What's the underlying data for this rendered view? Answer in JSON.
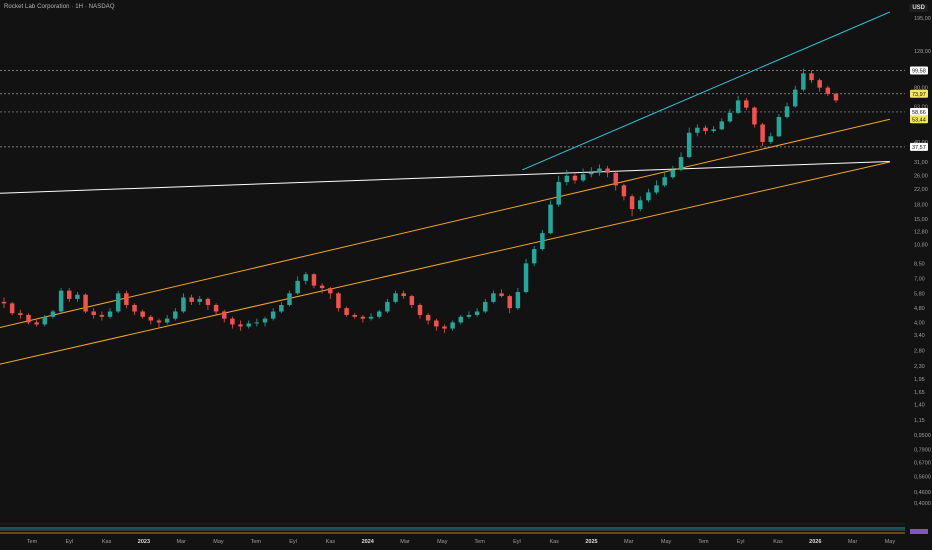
{
  "header": {
    "title": "Rocket Lab Corporation · 1H · NASDAQ",
    "currency": "USD"
  },
  "chart_data": {
    "type": "candlestick",
    "title": "Rocket Lab Corporation · 1H · NASDAQ",
    "y_scale": "log",
    "ylim": [
      0.33,
      210
    ],
    "y_ticks": [
      "195,00",
      "128,00",
      "80,00",
      "63,00",
      "40,00",
      "31,00",
      "26,00",
      "22,00",
      "18,00",
      "15,00",
      "12,80",
      "10,80",
      "8,50",
      "7,00",
      "5,80",
      "4,80",
      "4,00",
      "3,40",
      "2,80",
      "2,30",
      "1,95",
      "1,65",
      "1,40",
      "1,15",
      "0,9500",
      "0,7900",
      "0,6700",
      "0,5600",
      "0,4600",
      "0,4000"
    ],
    "x_ticks": [
      "Tem",
      "Eyl",
      "Kas",
      "2023",
      "Mar",
      "May",
      "Tem",
      "Eyl",
      "Kas",
      "2024",
      "Mar",
      "May",
      "Tem",
      "Eyl",
      "Kas",
      "2025",
      "Mar",
      "May",
      "Tem",
      "Eyl",
      "Kas",
      "2026",
      "Mar",
      "May"
    ],
    "x_ticks_bold": [
      "2023",
      "2024",
      "2025",
      "2026"
    ],
    "price_labels": [
      {
        "text": "99,58",
        "value": 99.58,
        "style": "white"
      },
      {
        "text": "73,97",
        "value": 73.97,
        "style": "yellow"
      },
      {
        "text": "58,66",
        "value": 58.66,
        "style": "white"
      },
      {
        "text": "53,44",
        "value": 53.44,
        "style": "yellow"
      },
      {
        "text": "37,57",
        "value": 37.57,
        "style": "white"
      }
    ],
    "horizontal_levels": [
      99.58,
      73.97,
      58.66,
      37.57
    ],
    "trendlines": [
      {
        "color": "#ffffff",
        "from": [
          "Tem 2022",
          20.8
        ],
        "to": [
          "May 2026",
          31.2
        ]
      },
      {
        "color": "#f5a623",
        "from": [
          "Tem 2022",
          3.75
        ],
        "to": [
          "May 2026",
          53.44
        ]
      },
      {
        "color": "#f5a623",
        "from": [
          "Tem 2022",
          2.35
        ],
        "to": [
          "May 2026",
          31.0
        ]
      },
      {
        "color": "#26c6da",
        "from": [
          "Kas 2024",
          28.0
        ],
        "to": [
          "May 2026",
          210
        ]
      }
    ],
    "candles": [
      [
        5.2,
        5.1,
        5.5,
        4.8
      ],
      [
        5.1,
        4.5,
        5.2,
        4.4
      ],
      [
        4.5,
        4.4,
        4.7,
        4.2
      ],
      [
        4.4,
        4.0,
        4.5,
        3.9
      ],
      [
        4.0,
        3.9,
        4.2,
        3.8
      ],
      [
        3.9,
        4.3,
        4.4,
        3.8
      ],
      [
        4.3,
        4.6,
        4.7,
        4.2
      ],
      [
        4.6,
        6.0,
        6.2,
        4.5
      ],
      [
        6.0,
        5.4,
        6.2,
        5.2
      ],
      [
        5.4,
        5.7,
        5.9,
        5.2
      ],
      [
        5.7,
        4.6,
        5.8,
        4.5
      ],
      [
        4.6,
        4.4,
        4.8,
        4.2
      ],
      [
        4.4,
        4.3,
        4.6,
        4.1
      ],
      [
        4.3,
        4.6,
        4.8,
        4.2
      ],
      [
        4.6,
        5.8,
        6.0,
        4.5
      ],
      [
        5.8,
        5.0,
        6.0,
        4.8
      ],
      [
        5.0,
        4.6,
        5.1,
        4.4
      ],
      [
        4.6,
        4.3,
        4.7,
        4.2
      ],
      [
        4.3,
        4.1,
        4.4,
        3.9
      ],
      [
        4.1,
        4.0,
        4.2,
        3.7
      ],
      [
        4.0,
        4.2,
        4.4,
        3.9
      ],
      [
        4.2,
        4.6,
        4.8,
        4.1
      ],
      [
        4.6,
        5.5,
        5.8,
        4.5
      ],
      [
        5.5,
        5.2,
        5.7,
        5.0
      ],
      [
        5.2,
        5.4,
        5.6,
        5.0
      ],
      [
        5.4,
        5.0,
        5.5,
        4.7
      ],
      [
        5.0,
        4.6,
        5.1,
        4.4
      ],
      [
        4.6,
        4.2,
        4.7,
        4.0
      ],
      [
        4.2,
        3.9,
        4.3,
        3.7
      ],
      [
        3.9,
        3.8,
        4.1,
        3.6
      ],
      [
        3.8,
        3.95,
        4.1,
        3.7
      ],
      [
        3.95,
        4.0,
        4.2,
        3.8
      ],
      [
        4.0,
        4.2,
        4.3,
        3.8
      ],
      [
        4.2,
        4.6,
        4.8,
        4.1
      ],
      [
        4.6,
        5.0,
        5.2,
        4.5
      ],
      [
        5.0,
        5.8,
        6.0,
        4.9
      ],
      [
        5.8,
        6.8,
        7.2,
        5.7
      ],
      [
        6.8,
        7.4,
        7.6,
        6.5
      ],
      [
        7.4,
        6.4,
        7.5,
        6.2
      ],
      [
        6.4,
        6.2,
        6.6,
        5.8
      ],
      [
        6.2,
        5.8,
        6.3,
        5.4
      ],
      [
        5.8,
        4.8,
        5.9,
        4.6
      ],
      [
        4.8,
        4.4,
        4.9,
        4.3
      ],
      [
        4.4,
        4.3,
        4.5,
        4.2
      ],
      [
        4.3,
        4.2,
        4.4,
        4.0
      ],
      [
        4.2,
        4.3,
        4.5,
        4.1
      ],
      [
        4.3,
        4.6,
        4.7,
        4.2
      ],
      [
        4.6,
        5.2,
        5.4,
        4.5
      ],
      [
        5.2,
        5.8,
        6.0,
        5.1
      ],
      [
        5.8,
        5.6,
        6.0,
        5.4
      ],
      [
        5.6,
        5.0,
        5.7,
        4.8
      ],
      [
        5.0,
        4.4,
        5.1,
        4.2
      ],
      [
        4.4,
        4.1,
        4.5,
        3.9
      ],
      [
        4.1,
        3.8,
        4.2,
        3.6
      ],
      [
        3.8,
        3.7,
        3.9,
        3.5
      ],
      [
        3.7,
        4.0,
        4.1,
        3.6
      ],
      [
        4.0,
        4.3,
        4.4,
        3.9
      ],
      [
        4.3,
        4.4,
        4.6,
        4.2
      ],
      [
        4.4,
        4.6,
        4.8,
        4.3
      ],
      [
        4.6,
        5.2,
        5.4,
        4.5
      ],
      [
        5.2,
        5.8,
        6.0,
        5.1
      ],
      [
        5.8,
        5.6,
        6.1,
        5.5
      ],
      [
        5.6,
        4.8,
        5.7,
        4.5
      ],
      [
        4.8,
        5.9,
        6.2,
        4.7
      ],
      [
        5.9,
        8.5,
        9.0,
        5.8
      ],
      [
        8.5,
        10.2,
        10.6,
        8.2
      ],
      [
        10.2,
        12.5,
        13.0,
        10.0
      ],
      [
        12.5,
        18.0,
        19.0,
        12.3
      ],
      [
        18.0,
        24.0,
        26.0,
        17.5
      ],
      [
        24.0,
        26.0,
        28.0,
        23.0
      ],
      [
        26.0,
        24.5,
        27.0,
        23.5
      ],
      [
        24.5,
        26.5,
        28.5,
        24.0
      ],
      [
        26.5,
        27.0,
        29.0,
        25.5
      ],
      [
        27.0,
        28.5,
        30.0,
        26.0
      ],
      [
        28.5,
        27.0,
        29.5,
        25.5
      ],
      [
        27.0,
        23.0,
        27.5,
        21.5
      ],
      [
        23.0,
        20.0,
        23.5,
        19.0
      ],
      [
        20.0,
        17.0,
        20.5,
        15.5
      ],
      [
        17.0,
        19.0,
        20.0,
        16.5
      ],
      [
        19.0,
        21.0,
        22.0,
        18.5
      ],
      [
        21.0,
        23.0,
        24.5,
        20.5
      ],
      [
        23.0,
        25.5,
        27.0,
        22.5
      ],
      [
        25.5,
        28.0,
        29.5,
        25.0
      ],
      [
        28.0,
        33.0,
        35.0,
        27.5
      ],
      [
        33.0,
        45.0,
        48.0,
        32.5
      ],
      [
        45.0,
        48.0,
        50.0,
        43.0
      ],
      [
        48.0,
        46.0,
        49.5,
        44.0
      ],
      [
        46.0,
        47.0,
        49.0,
        45.0
      ],
      [
        47.0,
        52.0,
        54.0,
        46.5
      ],
      [
        52.0,
        58.0,
        61.0,
        51.0
      ],
      [
        58.0,
        68.0,
        72.0,
        57.0
      ],
      [
        68.0,
        62.0,
        70.0,
        60.0
      ],
      [
        62.0,
        50.0,
        63.0,
        48.0
      ],
      [
        50.0,
        40.0,
        51.0,
        38.0
      ],
      [
        40.0,
        43.0,
        45.0,
        39.0
      ],
      [
        43.0,
        55.0,
        57.0,
        42.5
      ],
      [
        55.0,
        63.0,
        66.0,
        54.0
      ],
      [
        63.0,
        78.0,
        82.0,
        62.0
      ],
      [
        78.0,
        96.0,
        102.0,
        76.0
      ],
      [
        96.0,
        88.0,
        100.0,
        85.0
      ],
      [
        88.0,
        80.0,
        90.0,
        76.0
      ],
      [
        80.0,
        74.0,
        82.0,
        72.0
      ],
      [
        74.0,
        68.0,
        75.0,
        66.0
      ]
    ]
  }
}
